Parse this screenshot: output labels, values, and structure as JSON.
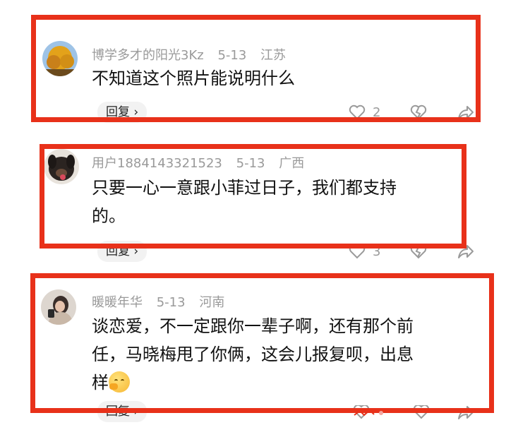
{
  "comments": [
    {
      "username": "博学多才的阳光3Kz",
      "date": "5-13",
      "location": "江苏",
      "text": "不知道这个照片能说明什么",
      "reply_label": "回复 ›",
      "like_count": "2",
      "avatar_icon": "autumn-tree-avatar"
    },
    {
      "username": "用户1884143321523",
      "date": "5-13",
      "location": "广西",
      "text_line1": "只要一心一意跟小菲过日子，我们都支持",
      "text_line2": "的。",
      "reply_label": "回复 ›",
      "like_count": "3",
      "avatar_icon": "dog-avatar"
    },
    {
      "username": "暖暖年华",
      "date": "5-13",
      "location": "河南",
      "text_line1": "谈恋爱，不一定跟你一辈子啊，还有那个前",
      "text_line2": "任，马晓梅甩了你俩，这会儿报复呗，出息",
      "text_line3": "样",
      "emoji": "thinking-face-emoji",
      "reply_label": "回复 ›",
      "avatar_icon": "woman-photo-avatar"
    }
  ],
  "colors": {
    "highlight_frame": "#e8311a",
    "meta_text": "#9a9a9a",
    "body_text": "#111111"
  }
}
